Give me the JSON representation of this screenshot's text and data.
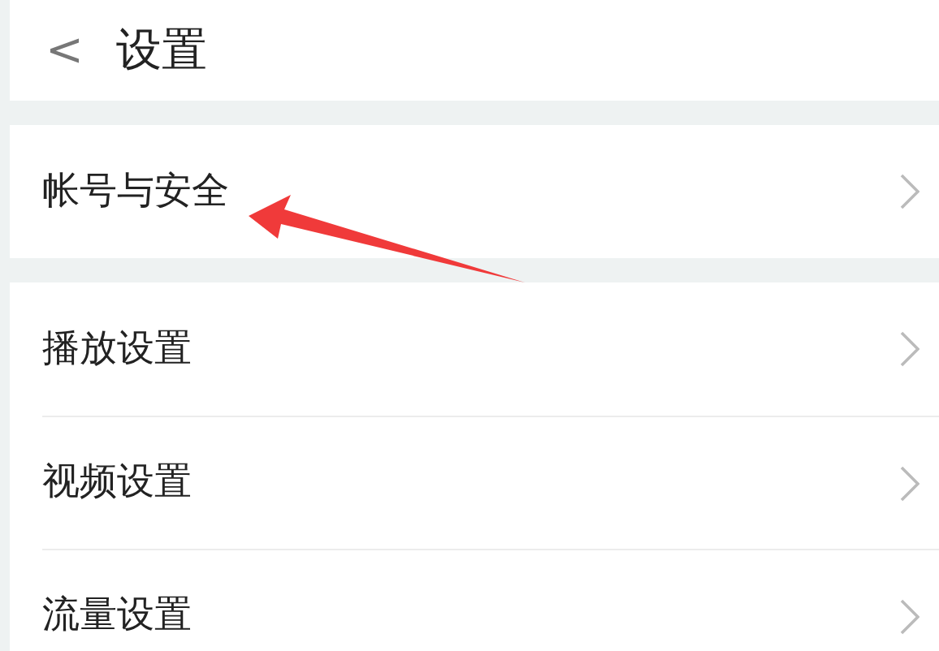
{
  "header": {
    "back": "<",
    "title": "设置"
  },
  "sections": [
    {
      "items": [
        {
          "label": "帐号与安全"
        }
      ]
    },
    {
      "items": [
        {
          "label": "播放设置"
        },
        {
          "label": "视频设置"
        },
        {
          "label": "流量设置"
        }
      ]
    }
  ]
}
